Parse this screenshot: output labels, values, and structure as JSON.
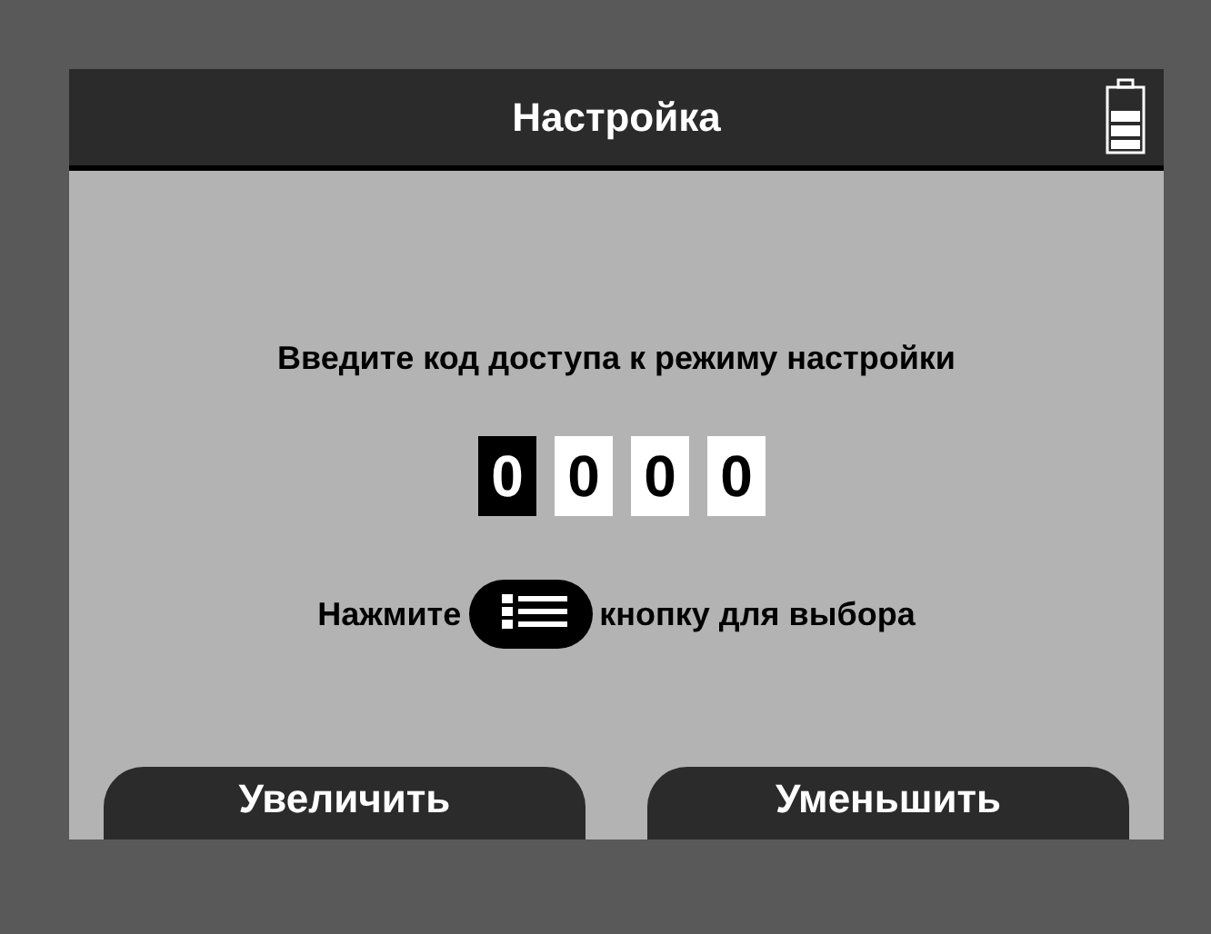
{
  "title": "Настройка",
  "prompt": "Введите код доступа к режиму настройки",
  "digits": [
    {
      "value": "0",
      "selected": true
    },
    {
      "value": "0",
      "selected": false
    },
    {
      "value": "0",
      "selected": false
    },
    {
      "value": "0",
      "selected": false
    }
  ],
  "hint": {
    "before": "Нажмите",
    "after": "кнопку для выбора"
  },
  "buttons": [
    "Увеличить",
    "Уменьшить"
  ]
}
